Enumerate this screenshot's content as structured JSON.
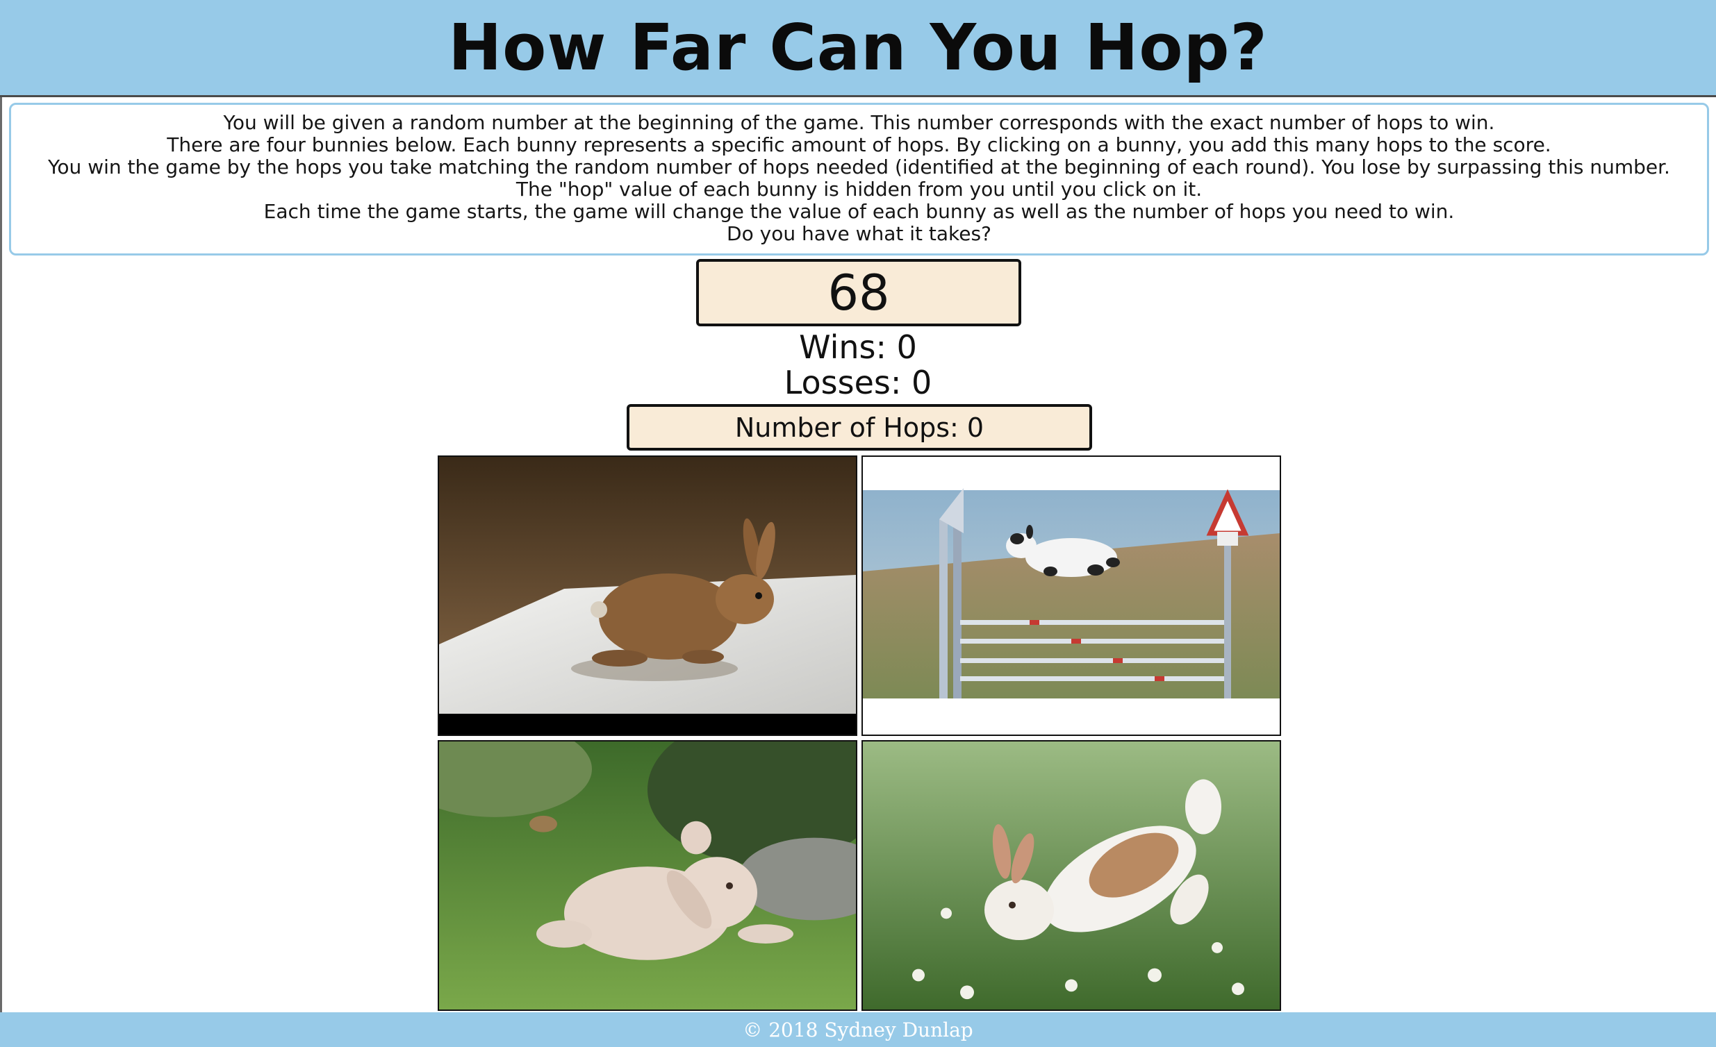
{
  "header": {
    "title": "How Far Can You Hop?"
  },
  "instructions": [
    "You will be given a random number at the beginning of the game. This number corresponds with the exact number of hops to win.",
    "There are four bunnies below. Each bunny represents a specific amount of hops. By clicking on a bunny, you add this many hops to the score.",
    "You win the game by the hops you take matching the random number of hops needed (identified at the beginning of each round). You lose by surpassing this number.",
    "The \"hop\" value of each bunny is hidden from you until you click on it.",
    "Each time the game starts, the game will change the value of each bunny as well as the number of hops you need to win.",
    "Do you have what it takes?"
  ],
  "game": {
    "target_number": "68",
    "wins": "Wins: 0",
    "losses": "Losses: 0",
    "hops": "Number of Hops: 0"
  },
  "bunnies": [
    {
      "icon": "brown-bunny-indoors-image"
    },
    {
      "icon": "bunny-jumping-hurdle-image"
    },
    {
      "icon": "fluffy-bunny-on-grass-image"
    },
    {
      "icon": "bunny-leaping-in-clover-image"
    }
  ],
  "footer": {
    "copyright": "© 2018 Sydney Dunlap"
  },
  "colors": {
    "header_bg": "#97cae8",
    "box_bg": "#f9ebd7",
    "instruction_border": "#97cae8",
    "footer_text": "#ffffff"
  }
}
